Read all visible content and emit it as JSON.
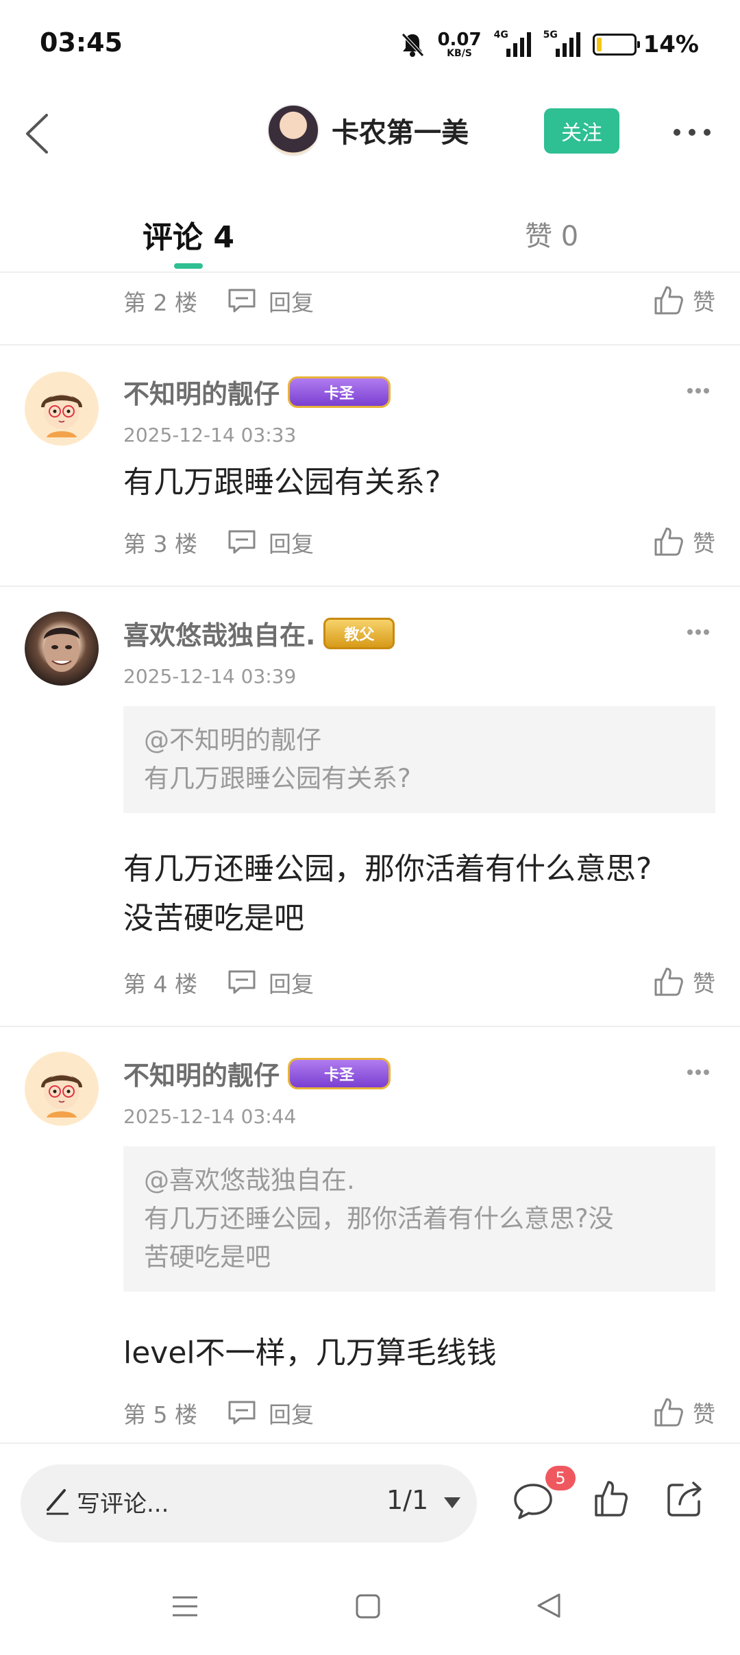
{
  "status_bar": {
    "time": "03:45",
    "net_speed": "0.07",
    "net_unit": "KB/S",
    "sim1_label": "4G",
    "sim2_label": "5G",
    "battery_level": 0.14,
    "battery_percent": "14%",
    "icons": [
      "mute-bell-icon",
      "signal-icon",
      "battery-icon"
    ]
  },
  "header": {
    "author_name": "卡农第一美",
    "follow_label": "关注"
  },
  "tabs": {
    "comments_label": "评论 4",
    "likes_label": "赞 0"
  },
  "comments": [
    {
      "floor": "第 2 楼",
      "reply_label": "回复",
      "like_label": "赞"
    },
    {
      "user": "不知明的靓仔",
      "badge": "卡圣",
      "time": "2025-12-14 03:33",
      "text": "有几万跟睡公园有关系?",
      "floor": "第 3 楼",
      "reply_label": "回复",
      "like_label": "赞"
    },
    {
      "user": "喜欢悠哉独自在.",
      "badge": "教父",
      "time": "2025-12-14 03:39",
      "quote_user": "@不知明的靓仔",
      "quote_text": "有几万跟睡公园有关系?",
      "text_line1": "有几万还睡公园，那你活着有什么意思?",
      "text_line2": "没苦硬吃是吧",
      "floor": "第 4 楼",
      "reply_label": "回复",
      "like_label": "赞"
    },
    {
      "user": "不知明的靓仔",
      "badge": "卡圣",
      "time": "2025-12-14 03:44",
      "quote_user": "@喜欢悠哉独自在.",
      "quote_text_line1": "有几万还睡公园，那你活着有什么意思?没",
      "quote_text_line2": "苦硬吃是吧",
      "text": "level不一样，几万算毛线钱",
      "floor": "第 5 楼",
      "reply_label": "回复",
      "like_label": "赞"
    }
  ],
  "bottom_bar": {
    "comment_placeholder": "写评论...",
    "page_indicator": "1/1",
    "comment_count_badge": "5"
  },
  "colors": {
    "accent": "#2ebf92",
    "badge_red": "#f0585f",
    "secondary_text": "#8a8a8a"
  }
}
